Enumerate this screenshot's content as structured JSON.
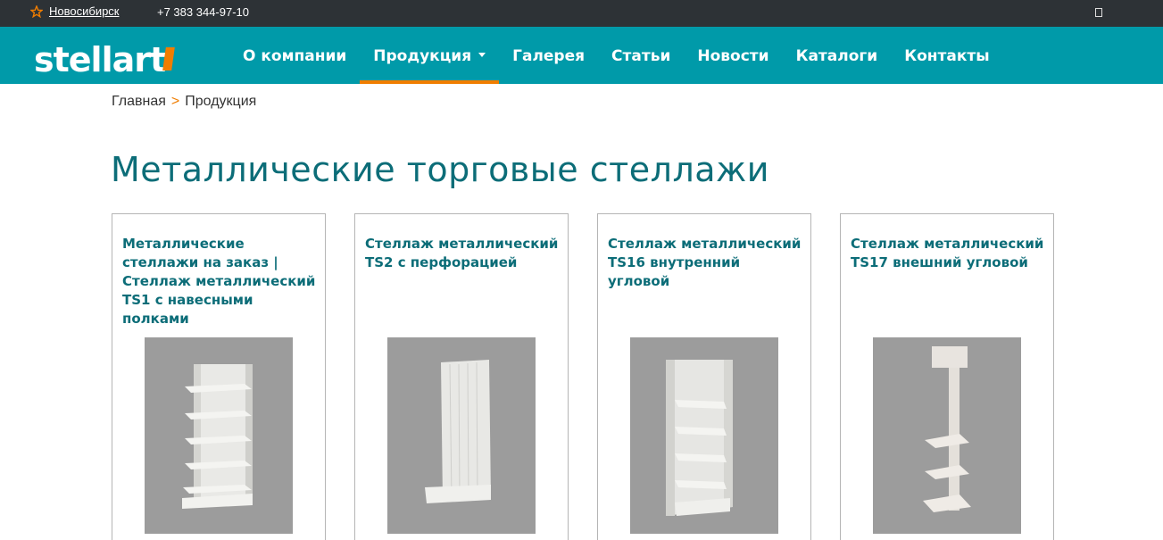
{
  "topbar": {
    "city": "Новосибирск",
    "phone": "+7 383 344-97-10"
  },
  "logo": {
    "text": "stellart"
  },
  "nav": [
    {
      "label": "О компании"
    },
    {
      "label": "Продукция"
    },
    {
      "label": "Галерея"
    },
    {
      "label": "Статьи"
    },
    {
      "label": "Новости"
    },
    {
      "label": "Каталоги"
    },
    {
      "label": "Контакты"
    }
  ],
  "breadcrumb": {
    "home": "Главная",
    "separator": ">",
    "current": "Продукция"
  },
  "page_title": "Металлические торговые стеллажи",
  "products": [
    {
      "title": "Металлические стеллажи на заказ | Стеллаж металлический TS1 с навесными полками",
      "image": "shelf-ts1-icon"
    },
    {
      "title": "Стеллаж металлический TS2 с перфорацией",
      "image": "shelf-ts2-icon"
    },
    {
      "title": "Стеллаж металлический TS16 внутренний угловой",
      "image": "shelf-ts16-icon"
    },
    {
      "title": "Стеллаж металлический TS17 внешний угловой",
      "image": "shelf-ts17-icon"
    }
  ],
  "colors": {
    "topbar_bg": "#2d3236",
    "nav_bg": "#009aa9",
    "accent": "#f07d00",
    "title_color": "#0c6d78"
  }
}
